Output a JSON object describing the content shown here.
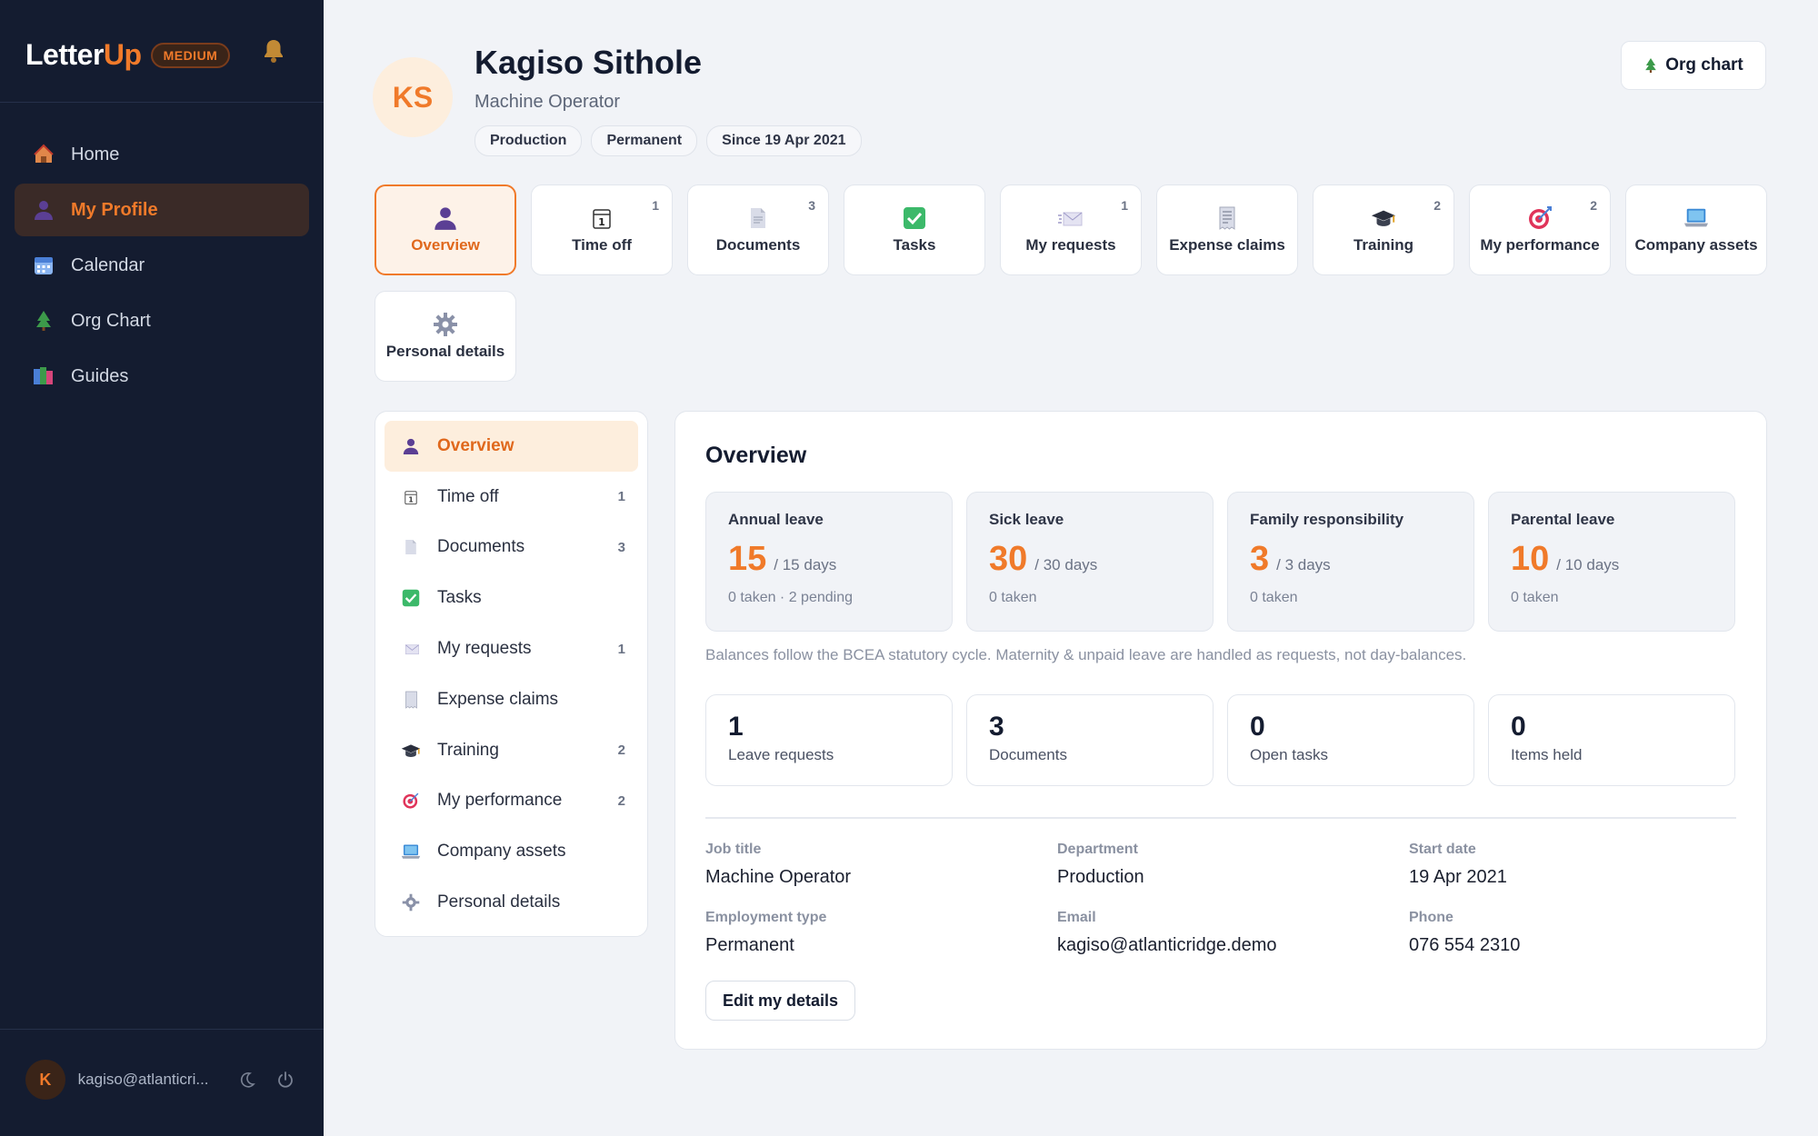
{
  "brand": {
    "name_part1": "Letter",
    "name_part2": "Up",
    "tier": "MEDIUM"
  },
  "nav": [
    {
      "label": "Home",
      "icon": "home-icon",
      "active": false
    },
    {
      "label": "My Profile",
      "icon": "person-icon",
      "active": true
    },
    {
      "label": "Calendar",
      "icon": "calendar-icon",
      "active": false
    },
    {
      "label": "Org Chart",
      "icon": "tree-icon",
      "active": false
    },
    {
      "label": "Guides",
      "icon": "books-icon",
      "active": false
    }
  ],
  "user": {
    "initial": "K",
    "email": "kagiso@atlanticri..."
  },
  "profile": {
    "initials": "KS",
    "name": "Kagiso Sithole",
    "role": "Machine Operator",
    "chips": [
      "Production",
      "Permanent",
      "Since 19 Apr 2021"
    ],
    "org_chart_button": "Org chart"
  },
  "tabs": [
    {
      "label": "Overview",
      "count": "",
      "icon": "person-icon",
      "active": true
    },
    {
      "label": "Time off",
      "count": "1",
      "icon": "calendar-day-icon"
    },
    {
      "label": "Documents",
      "count": "3",
      "icon": "document-icon"
    },
    {
      "label": "Tasks",
      "count": "",
      "icon": "checkbox-icon"
    },
    {
      "label": "My requests",
      "count": "1",
      "icon": "envelope-icon"
    },
    {
      "label": "Expense claims",
      "count": "",
      "icon": "receipt-icon"
    },
    {
      "label": "Training",
      "count": "2",
      "icon": "graduation-cap-icon"
    },
    {
      "label": "My performance",
      "count": "2",
      "icon": "target-icon"
    },
    {
      "label": "Company assets",
      "count": "",
      "icon": "laptop-icon"
    },
    {
      "label": "Personal details",
      "count": "",
      "icon": "gear-icon"
    }
  ],
  "side_list": [
    {
      "label": "Overview",
      "count": "",
      "icon": "person-icon",
      "active": true
    },
    {
      "label": "Time off",
      "count": "1",
      "icon": "calendar-day-icon"
    },
    {
      "label": "Documents",
      "count": "3",
      "icon": "document-icon"
    },
    {
      "label": "Tasks",
      "count": "",
      "icon": "checkbox-icon"
    },
    {
      "label": "My requests",
      "count": "1",
      "icon": "envelope-icon"
    },
    {
      "label": "Expense claims",
      "count": "",
      "icon": "receipt-icon"
    },
    {
      "label": "Training",
      "count": "2",
      "icon": "graduation-cap-icon"
    },
    {
      "label": "My performance",
      "count": "2",
      "icon": "target-icon"
    },
    {
      "label": "Company assets",
      "count": "",
      "icon": "laptop-icon"
    },
    {
      "label": "Personal details",
      "count": "",
      "icon": "gear-icon"
    }
  ],
  "overview": {
    "title": "Overview",
    "leave": [
      {
        "name": "Annual leave",
        "value": "15",
        "total": "/ 15 days",
        "sub": "0 taken · 2 pending"
      },
      {
        "name": "Sick leave",
        "value": "30",
        "total": "/ 30 days",
        "sub": "0 taken"
      },
      {
        "name": "Family responsibility",
        "value": "3",
        "total": "/ 3 days",
        "sub": "0 taken"
      },
      {
        "name": "Parental leave",
        "value": "10",
        "total": "/ 10 days",
        "sub": "0 taken"
      }
    ],
    "note": "Balances follow the BCEA statutory cycle. Maternity & unpaid leave are handled as requests, not day-balances.",
    "stats": [
      {
        "value": "1",
        "label": "Leave requests"
      },
      {
        "value": "3",
        "label": "Documents"
      },
      {
        "value": "0",
        "label": "Open tasks"
      },
      {
        "value": "0",
        "label": "Items held"
      }
    ],
    "details": [
      {
        "label": "Job title",
        "value": "Machine Operator"
      },
      {
        "label": "Department",
        "value": "Production"
      },
      {
        "label": "Start date",
        "value": "19 Apr 2021"
      },
      {
        "label": "Employment type",
        "value": "Permanent"
      },
      {
        "label": "Email",
        "value": "kagiso@atlanticridge.demo"
      },
      {
        "label": "Phone",
        "value": "076 554 2310"
      }
    ],
    "edit_button": "Edit my details"
  },
  "colors": {
    "accent": "#f07a2a",
    "sidebar": "#141c30",
    "page": "#f1f3f7"
  }
}
